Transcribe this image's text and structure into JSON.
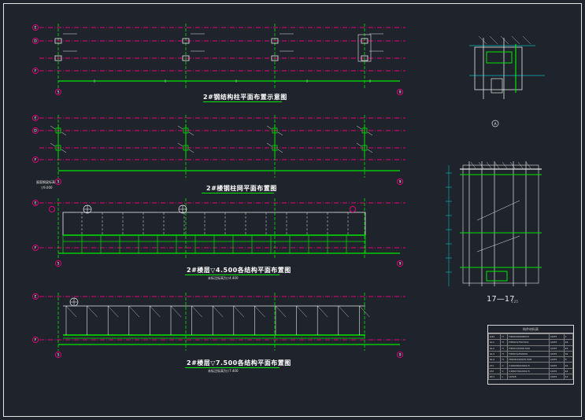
{
  "drawing": {
    "plans": [
      {
        "title": "2#钢结构柱平面布置示意图",
        "subtitle": ""
      },
      {
        "title": "2#楼钢柱网平面布置图",
        "subtitle": ""
      },
      {
        "title": "2#楼层▽4.500各结构平面布置图",
        "subtitle": "未标注标高为▽4.400"
      },
      {
        "title": "2#楼层▽7.500各结构平面布置图",
        "subtitle": "未标注标高为▽7.400"
      }
    ],
    "axis_labels": {
      "top": "E",
      "mid": "D",
      "low": "F",
      "start": "5",
      "end": "9"
    },
    "side_note": {
      "line1": "屋面钢梁标高",
      "line2": "▽9.000"
    },
    "section": {
      "label": "17—17",
      "scale": "1:25",
      "detail_tag": "A"
    },
    "schedule": {
      "title": "构件材料表",
      "rows": [
        [
          "GZ1",
          "H",
          "H400X200X8X13",
          "Q235",
          "2"
        ],
        [
          "GL1",
          "H",
          "H350X175X7X11",
          "Q235",
          "16"
        ],
        [
          "GL2",
          "H",
          "H300X150X6.5X9",
          "Q235",
          "24"
        ],
        [
          "GL3",
          "H",
          "H250X125X6X9",
          "Q235",
          "32"
        ],
        [
          "GL4",
          "H",
          "HN200X100X5.5X8",
          "Q235",
          "8"
        ],
        [
          "LT1",
          "C",
          "C160X60X20X2.5",
          "Q235",
          "44"
        ],
        [
          "LT2",
          "C",
          "C180X70X20X2.5",
          "Q235",
          "44"
        ],
        [
          "ZC1",
          "L",
          "L63X5",
          "Q235",
          "12"
        ]
      ]
    }
  },
  "colors": {
    "background": "#1f232b",
    "grid_axis": "#e0007a",
    "beam": "#00e600",
    "detail": "#e6e6e6",
    "dim": "#00ffff"
  },
  "icons": [
    "axis-bubble-icon",
    "section-marker-icon"
  ]
}
